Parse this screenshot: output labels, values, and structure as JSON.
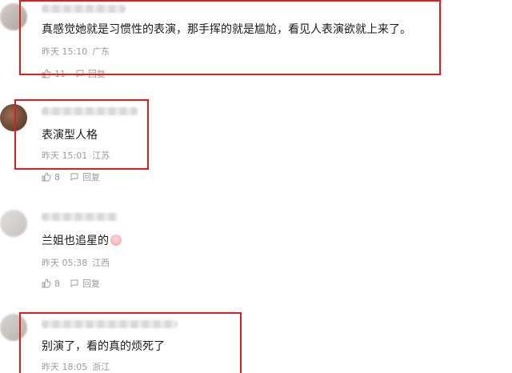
{
  "comments": [
    {
      "text": "真感觉她就是习惯性的表演，那手挥的就是尴尬，看见人表演欲就上来了。",
      "time": "昨天 15:10",
      "location": "广东",
      "likes": "11",
      "reply_label": "回复"
    },
    {
      "text": "表演型人格",
      "time": "昨天 15:01",
      "location": "江苏",
      "likes": "8",
      "reply_label": "回复"
    },
    {
      "text": "兰姐也追星的",
      "time": "昨天 05:38",
      "location": "江西",
      "likes": "8",
      "reply_label": "回复"
    },
    {
      "text": "别演了，看的真的烦死了",
      "time": "昨天 18:05",
      "location": "浙江"
    }
  ],
  "colors": {
    "highlight": "#d8201f",
    "meta_gray": "#9a9a9a"
  }
}
